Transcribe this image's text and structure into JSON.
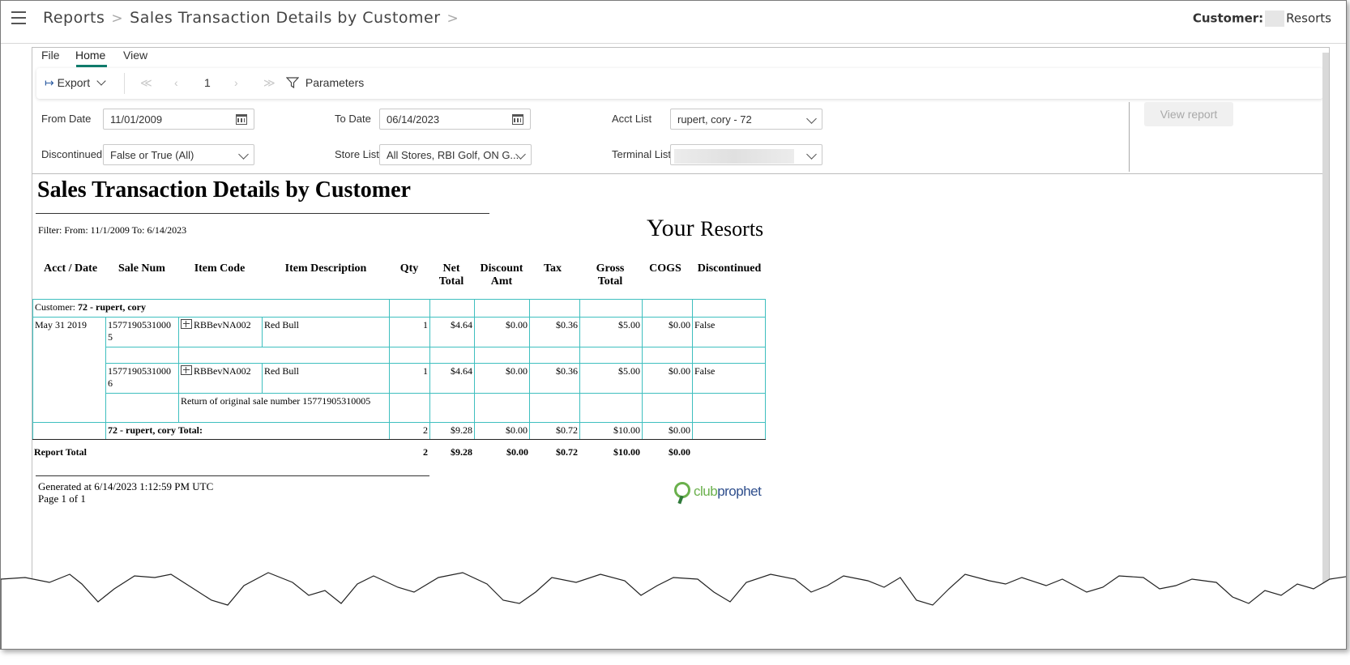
{
  "header": {
    "crumbs": [
      "Reports",
      "Sales Transaction Details by Customer"
    ],
    "customer_label": "Customer:",
    "customer_value": "Resorts"
  },
  "menu": {
    "file": "File",
    "home": "Home",
    "view": "View"
  },
  "toolbar": {
    "export": "Export",
    "page": "1",
    "parameters": "Parameters"
  },
  "params": {
    "from_date_label": "From Date",
    "from_date_value": "11/01/2009",
    "to_date_label": "To Date",
    "to_date_value": "06/14/2023",
    "acct_list_label": "Acct List",
    "acct_list_value": "rupert, cory - 72",
    "discontinued_label": "Discontinued",
    "discontinued_value": "False or True (All)",
    "store_list_label": "Store List",
    "store_list_value": "All Stores, RBI Golf, ON G...",
    "terminal_list_label": "Terminal List",
    "view_report": "View report"
  },
  "report": {
    "title": "Sales Transaction Details by Customer",
    "filter": "Filter:   From: 11/1/2009 To: 6/14/2023",
    "logo_your": "Your",
    "logo_resorts": "Resorts",
    "columns": {
      "acct_date": "Acct / Date",
      "sale_num": "Sale Num",
      "item_code": "Item Code",
      "item_desc": "Item Description",
      "qty": "Qty",
      "net_total_1": "Net",
      "net_total_2": "Total",
      "discount_1": "Discount",
      "discount_2": "Amt",
      "tax": "Tax",
      "gross_1": "Gross",
      "gross_2": "Total",
      "cogs": "COGS",
      "discontinued": "Discontinued"
    },
    "customer_prefix": "Customer:",
    "customer_name": "72 - rupert, cory",
    "date": "May 31 2019",
    "rows": [
      {
        "sale_a": "1577190531000",
        "sale_b": "5",
        "item_code": "RBBevNA002",
        "desc": "Red Bull",
        "qty": "1",
        "net": "$4.64",
        "disc": "$0.00",
        "tax": "$0.36",
        "gross": "$5.00",
        "cogs": "$0.00",
        "discontinued": "False"
      },
      {
        "sale_a": "1577190531000",
        "sale_b": "6",
        "item_code": "RBBevNA002",
        "desc": "Red Bull",
        "qty": "1",
        "net": "$4.64",
        "disc": "$0.00",
        "tax": "$0.36",
        "gross": "$5.00",
        "cogs": "$0.00",
        "discontinued": "False"
      }
    ],
    "return_note": "Return of original sale number 15771905310005",
    "subtotal": {
      "label": "72 - rupert, cory Total:",
      "qty": "2",
      "net": "$9.28",
      "disc": "$0.00",
      "tax": "$0.72",
      "gross": "$10.00",
      "cogs": "$0.00"
    },
    "report_total": {
      "label": "Report Total",
      "qty": "2",
      "net": "$9.28",
      "disc": "$0.00",
      "tax": "$0.72",
      "gross": "$10.00",
      "cogs": "$0.00"
    },
    "generated": "Generated at 6/14/2023 1:12:59 PM UTC",
    "page": "Page 1 of 1",
    "brand_1": "club",
    "brand_2": "prophet"
  }
}
